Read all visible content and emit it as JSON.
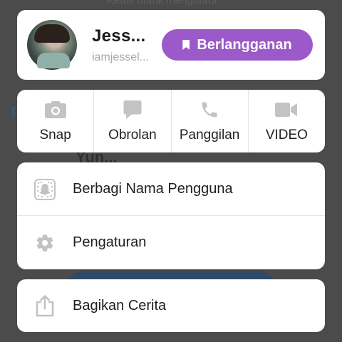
{
  "background": {
    "top_hint": "Ketuk untuk mengobrol",
    "name_partial": "Yun...",
    "letter": "F"
  },
  "profile": {
    "display_name": "Jess...",
    "username": "iamjessel...",
    "subscribe_label": "Berlangganan",
    "subscribe_color": "#9b59c9"
  },
  "actions": [
    {
      "label": "Snap",
      "icon": "camera-icon"
    },
    {
      "label": "Obrolan",
      "icon": "chat-icon"
    },
    {
      "label": "Panggilan",
      "icon": "phone-icon"
    },
    {
      "label": "VIDEO",
      "icon": "video-camera-icon"
    }
  ],
  "menu": {
    "share_username": "Berbagi Nama Pengguna",
    "settings": "Pengaturan",
    "share_story": "Bagikan Cerita"
  },
  "colors": {
    "icon_gray": "#c3c3c3",
    "overlay": "#4b4b4b"
  }
}
